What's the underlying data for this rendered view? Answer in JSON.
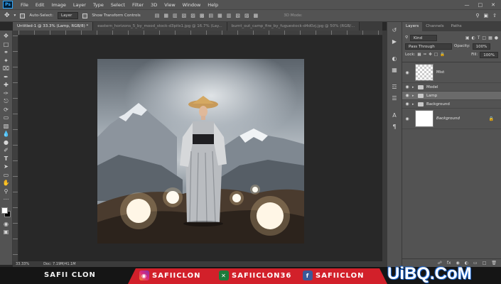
{
  "menubar": {
    "logo": "Ps",
    "items": [
      "File",
      "Edit",
      "Image",
      "Layer",
      "Type",
      "Select",
      "Filter",
      "3D",
      "View",
      "Window",
      "Help"
    ]
  },
  "options": {
    "auto_select_label": "Auto-Select:",
    "auto_select_value": "Layer",
    "transform_label": "Show Transform Controls",
    "mode_3d": "3D Mode:"
  },
  "tabs": [
    {
      "label": "Untitled-1 @ 33.3% (Lamp, RGB/8) *",
      "active": true
    },
    {
      "label": "eastern_horizons_5_by_mood_stock-d3pits1.jpg @ 16.7% (Lay...",
      "active": false
    },
    {
      "label": "burnt_out_camp_fire_by_fuguestock-d4d0zj.jpg @ 50% (RGB/...",
      "active": false
    }
  ],
  "status": {
    "zoom": "33.33%",
    "doc": "Doc: 7.19M/41.1M"
  },
  "panel": {
    "tabs": [
      "Layers",
      "Channels",
      "Paths"
    ],
    "kind": "Kind",
    "blend_mode": "Pass Through",
    "opacity_label": "Opacity:",
    "opacity_value": "100%",
    "lock_label": "Lock:",
    "fill_label": "Fill:",
    "fill_value": "100%",
    "layers": {
      "mist": "Mist",
      "model": "Model",
      "lamp": "Lamp",
      "background_group": "Background",
      "background": "Background"
    }
  },
  "banner": {
    "name": "SAFII CLON",
    "instagram": "SAFIICLON",
    "x": "SAFIICLON36",
    "facebook": "SAFIICLON",
    "watermark": "UiBQ.CoM"
  },
  "colors": {
    "foreground": "#ffffff",
    "background": "#000000",
    "banner_red": "#d2202a"
  }
}
